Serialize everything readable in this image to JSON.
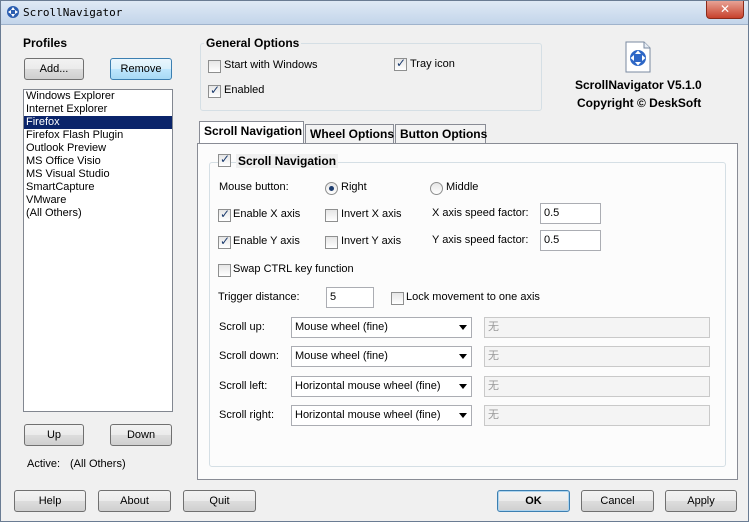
{
  "window": {
    "title": "ScrollNavigator",
    "close_glyph": "✕"
  },
  "profiles": {
    "title": "Profiles",
    "add_label": "Add...",
    "remove_label": "Remove",
    "items": [
      "Windows Explorer",
      "Internet Explorer",
      "Firefox",
      "Firefox Flash Plugin",
      "Outlook Preview",
      "MS Office Visio",
      "MS Visual Studio",
      "SmartCapture",
      "VMware",
      "(All Others)"
    ],
    "selected_index": 2,
    "up_label": "Up",
    "down_label": "Down",
    "active_label": "Active:",
    "active_value": "(All Others)"
  },
  "general": {
    "title": "General Options",
    "start_with_windows": {
      "label": "Start with Windows",
      "checked": false
    },
    "tray_icon": {
      "label": "Tray icon",
      "checked": true
    },
    "enabled": {
      "label": "Enabled",
      "checked": true
    }
  },
  "about": {
    "product": "ScrollNavigator V5.1.0",
    "copyright": "Copyright © DeskSoft",
    "icon": "move-arrows-icon"
  },
  "tabs": [
    {
      "label": "Scroll Navigation",
      "active": true
    },
    {
      "label": "Wheel Options",
      "active": false
    },
    {
      "label": "Button Options",
      "active": false
    }
  ],
  "scroll_nav": {
    "section_label": "Scroll Navigation",
    "section_checked": true,
    "mouse_button_label": "Mouse button:",
    "right_label": "Right",
    "right_checked": true,
    "middle_label": "Middle",
    "middle_checked": false,
    "enable_x": {
      "label": "Enable X axis",
      "checked": true
    },
    "invert_x": {
      "label": "Invert X axis",
      "checked": false
    },
    "x_speed_label": "X axis speed factor:",
    "x_speed_value": "0.5",
    "enable_y": {
      "label": "Enable Y axis",
      "checked": true
    },
    "invert_y": {
      "label": "Invert Y axis",
      "checked": false
    },
    "y_speed_label": "Y axis speed factor:",
    "y_speed_value": "0.5",
    "swap_ctrl": {
      "label": "Swap CTRL key function",
      "checked": false
    },
    "trigger_label": "Trigger distance:",
    "trigger_value": "5",
    "lock_movement": {
      "label": "Lock movement to one axis",
      "checked": false
    },
    "rows": [
      {
        "label": "Scroll up:",
        "value": "Mouse wheel (fine)",
        "extra": "无"
      },
      {
        "label": "Scroll down:",
        "value": "Mouse wheel (fine)",
        "extra": "无"
      },
      {
        "label": "Scroll left:",
        "value": "Horizontal mouse wheel (fine)",
        "extra": "无"
      },
      {
        "label": "Scroll right:",
        "value": "Horizontal mouse wheel (fine)",
        "extra": "无"
      }
    ]
  },
  "footer": {
    "help_label": "Help",
    "about_label": "About",
    "quit_label": "Quit",
    "ok_label": "OK",
    "cancel_label": "Cancel",
    "apply_label": "Apply"
  }
}
